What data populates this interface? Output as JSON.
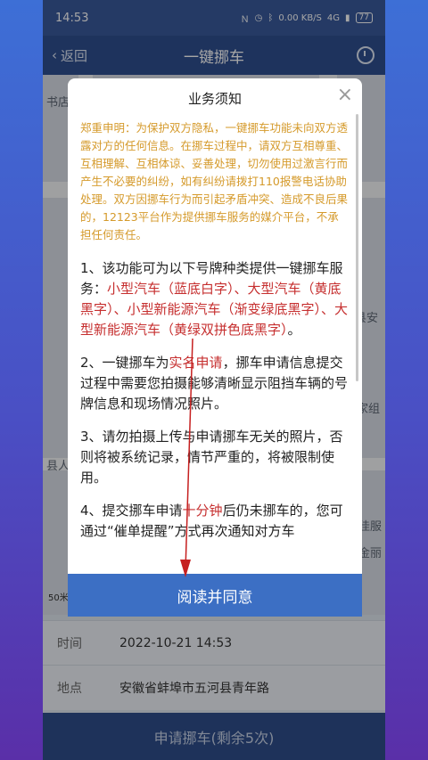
{
  "status": {
    "time": "14:53",
    "speed": "0.00 KB/S",
    "network": "4G",
    "battery": "77"
  },
  "nav": {
    "back_label": "返回",
    "title": "一键挪车"
  },
  "map": {
    "labels": [
      "书店",
      "县安",
      "家组",
      "县人",
      "佳服",
      "金丽"
    ],
    "scale": "50米"
  },
  "dialog": {
    "title": "业务须知",
    "disclaimer": "郑重申明：为保护双方隐私，一键挪车功能未向双方透露对方的任何信息。在挪车过程中，请双方互相尊重、互相理解、互相体谅、妥善处理，切勿使用过激言行而产生不必要的纠纷，如有纠纷请拨打110报警电话协助处理。双方因挪车行为而引起矛盾冲突、造成不良后果的，12123平台作为提供挪车服务的媒介平台，不承担任何责任。",
    "item1_prefix": "1、该功能可为以下号牌种类提供一键挪车服务：",
    "item1_highlight": "小型汽车（蓝底白字）、大型汽车（黄底黑字）、小型新能源汽车（渐变绿底黑字）、大型新能源汽车（黄绿双拼色底黑字）",
    "item1_suffix": "。",
    "item2_prefix": "2、一键挪车为",
    "item2_highlight": "实名申请",
    "item2_suffix": "，挪车申请信息提交过程中需要您拍摄能够清晰显示阻挡车辆的号牌信息和现场情况照片。",
    "item3": "3、请勿拍摄上传与申请挪车无关的照片，否则将被系统记录，情节严重的，将被限制使用。",
    "item4_prefix": "4、提交挪车申请",
    "item4_highlight": "十分钟",
    "item4_suffix": "后仍未挪车的，您可通过“催单提醒”方式再次通知对方车",
    "agree_label": "阅读并同意"
  },
  "info": {
    "time_key": "时间",
    "time_value": "2022-10-21 14:53",
    "place_key": "地点",
    "place_value": "安徽省蚌埠市五河县青年路"
  },
  "apply_label": "申请挪车(剩余5次)"
}
